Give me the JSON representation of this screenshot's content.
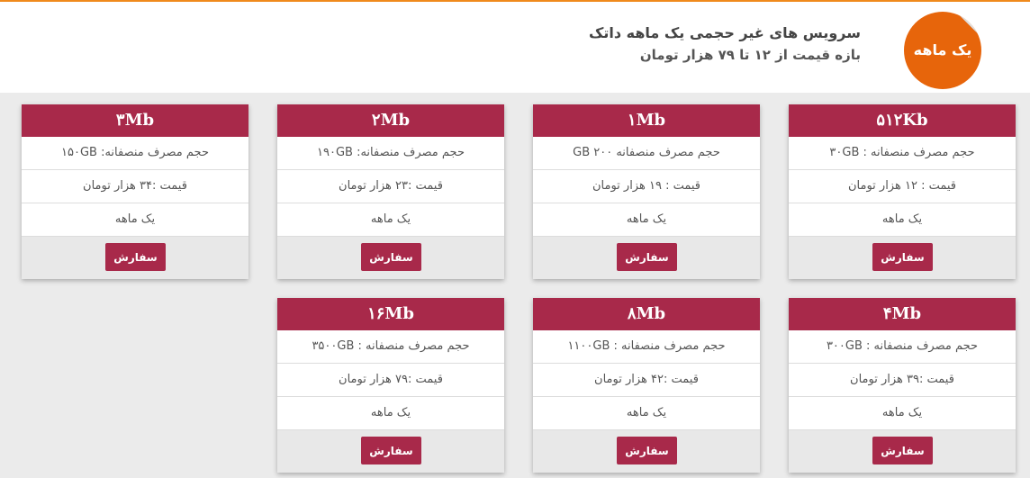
{
  "header": {
    "badge": "یک ماهه",
    "title": "سرویس های غیر حجمی یک ماهه داتک",
    "subtitle": "بازه قیمت از ۱۲ تا ۷۹ هزار تومان"
  },
  "colors": {
    "accent": "#a8294a",
    "badge": "#e7650b",
    "top_border": "#f08a1c"
  },
  "plans": [
    {
      "speed": "۵۱۲Kb",
      "quota": "حجم مصرف منصفانه : ۳۰GB",
      "price": "قیمت : ۱۲ هزار تومان",
      "period": "یک ماهه",
      "button": "سفارش"
    },
    {
      "speed": "۱Mb",
      "quota": "حجم مصرف منصفانه GB ۲۰۰",
      "price": "قیمت : ۱۹ هزار تومان",
      "period": "یک ماهه",
      "button": "سفارش"
    },
    {
      "speed": "۲Mb",
      "quota": "حجم مصرف منصفانه: ۱۹۰GB",
      "price": "قیمت :۲۳ هزار تومان",
      "period": "یک ماهه",
      "button": "سفارش"
    },
    {
      "speed": "۳Mb",
      "quota": "حجم مصرف منصفانه: ۱۵۰GB",
      "price": "قیمت :۳۴ هزار تومان",
      "period": "یک ماهه",
      "button": "سفارش"
    },
    {
      "speed": "۴Mb",
      "quota": "حجم مصرف منصفانه : ۳۰۰GB",
      "price": "قیمت :۳۹ هزار تومان",
      "period": "یک ماهه",
      "button": "سفارش"
    },
    {
      "speed": "۸Mb",
      "quota": "حجم مصرف منصفانه : ۱۱۰۰GB",
      "price": "قیمت :۴۲ هزار تومان",
      "period": "یک ماهه",
      "button": "سفارش"
    },
    {
      "speed": "۱۶Mb",
      "quota": "حجم مصرف منصفانه : ۳۵۰۰GB",
      "price": "قیمت :۷۹ هزار تومان",
      "period": "یک ماهه",
      "button": "سفارش"
    }
  ]
}
